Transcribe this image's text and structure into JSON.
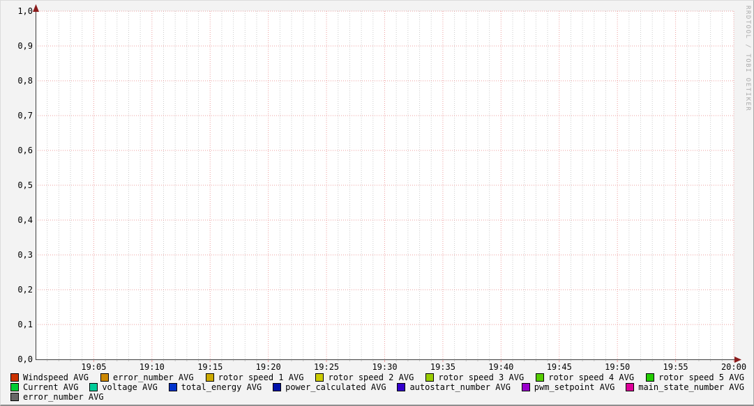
{
  "watermark": "RRDTOOL / TOBI OETIKER",
  "chart_data": {
    "type": "line",
    "title": "",
    "xlabel": "",
    "ylabel": "",
    "ylim": [
      0.0,
      1.0
    ],
    "y_major_step": 0.1,
    "y_ticks": [
      {
        "value": 0.0,
        "label": "0,0"
      },
      {
        "value": 0.1,
        "label": "0,1"
      },
      {
        "value": 0.2,
        "label": "0,2"
      },
      {
        "value": 0.3,
        "label": "0,3"
      },
      {
        "value": 0.4,
        "label": "0,4"
      },
      {
        "value": 0.5,
        "label": "0,5"
      },
      {
        "value": 0.6,
        "label": "0,6"
      },
      {
        "value": 0.7,
        "label": "0,7"
      },
      {
        "value": 0.8,
        "label": "0,8"
      },
      {
        "value": 0.9,
        "label": "0,9"
      },
      {
        "value": 1.0,
        "label": "1,0"
      }
    ],
    "x_range": {
      "start_minute": 0,
      "end_minute": 60,
      "minor_step_minutes": 1,
      "major_step_minutes": 5
    },
    "x_ticks": [
      {
        "minute": 5,
        "label": "19:05"
      },
      {
        "minute": 10,
        "label": "19:10"
      },
      {
        "minute": 15,
        "label": "19:15"
      },
      {
        "minute": 20,
        "label": "19:20"
      },
      {
        "minute": 25,
        "label": "19:25"
      },
      {
        "minute": 30,
        "label": "19:30"
      },
      {
        "minute": 35,
        "label": "19:35"
      },
      {
        "minute": 40,
        "label": "19:40"
      },
      {
        "minute": 45,
        "label": "19:45"
      },
      {
        "minute": 50,
        "label": "19:50"
      },
      {
        "minute": 55,
        "label": "19:55"
      },
      {
        "minute": 60,
        "label": "20:00"
      }
    ],
    "grid": {
      "canvas_color": "#FFFFFF",
      "background_color": "#F3F3F3",
      "major_grid_color": "#EE9E9E",
      "minor_grid_color": "#CBCBCB",
      "axis_color": "#3F3F3F",
      "arrow_color": "#8B1C1C",
      "font_color": "#000000",
      "grid_on": true,
      "legend_position": "bottom"
    },
    "series": [
      {
        "label": "Windspeed AVG",
        "color": "#CC3300",
        "legend_row": 0,
        "values": []
      },
      {
        "label": "error_number AVG",
        "color": "#CC8800",
        "legend_row": 0,
        "values": []
      },
      {
        "label": "rotor speed 1 AVG",
        "color": "#CCAA00",
        "legend_row": 0,
        "values": []
      },
      {
        "label": "rotor speed 2 AVG",
        "color": "#CCCC00",
        "legend_row": 0,
        "values": []
      },
      {
        "label": "rotor speed 3 AVG",
        "color": "#99CC00",
        "legend_row": 0,
        "values": []
      },
      {
        "label": "rotor speed 4 AVG",
        "color": "#55CC00",
        "legend_row": 0,
        "values": []
      },
      {
        "label": "rotor speed 5 AVG",
        "color": "#22CC00",
        "legend_row": 0,
        "values": []
      },
      {
        "label": "Current AVG",
        "color": "#00CC33",
        "legend_row": 1,
        "values": []
      },
      {
        "label": "voltage AVG",
        "color": "#00CC99",
        "legend_row": 1,
        "values": []
      },
      {
        "label": "total_energy AVG",
        "color": "#0033CC",
        "legend_row": 1,
        "values": []
      },
      {
        "label": "power_calculated AVG",
        "color": "#0011AA",
        "legend_row": 1,
        "values": []
      },
      {
        "label": "autostart_number AVG",
        "color": "#3300CC",
        "legend_row": 1,
        "values": []
      },
      {
        "label": "pwm_setpoint AVG",
        "color": "#9900CC",
        "legend_row": 1,
        "values": []
      },
      {
        "label": "main_state_number AVG",
        "color": "#DD0099",
        "legend_row": 1,
        "values": []
      },
      {
        "label": "error_number AVG",
        "color": "#666666",
        "legend_row": 2,
        "values": []
      }
    ]
  }
}
